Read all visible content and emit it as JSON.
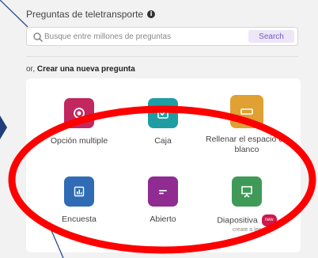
{
  "section_title": "Preguntas de teletransporte",
  "info_icon": "i",
  "search": {
    "placeholder": "Busque entre millones de preguntas",
    "button_label": "Search"
  },
  "create": {
    "prefix": "or, ",
    "link_label": "Crear una nueva pregunta"
  },
  "types": [
    {
      "label": "Opción multiple",
      "icon": "radio-button-icon",
      "color": "#c2275f"
    },
    {
      "label": "Caja",
      "icon": "checkbox-icon",
      "color": "#1e9ea3"
    },
    {
      "label": "Rellenar el espacio en blanco",
      "icon": "blank-field-icon",
      "color": "#e0a032"
    },
    {
      "label": "Encuesta",
      "icon": "poll-chart-icon",
      "color": "#2f6cb5"
    },
    {
      "label": "Abierto",
      "icon": "open-text-icon",
      "color": "#8f2b91"
    },
    {
      "label": "Diapositiva",
      "icon": "presentation-icon",
      "color": "#3f9a58",
      "badge": "new",
      "sub": "create a lec"
    }
  ],
  "colors": {
    "highlight": "#ff0000",
    "pointer_line": "#2a4a90",
    "accent": "#7a5ac7"
  }
}
